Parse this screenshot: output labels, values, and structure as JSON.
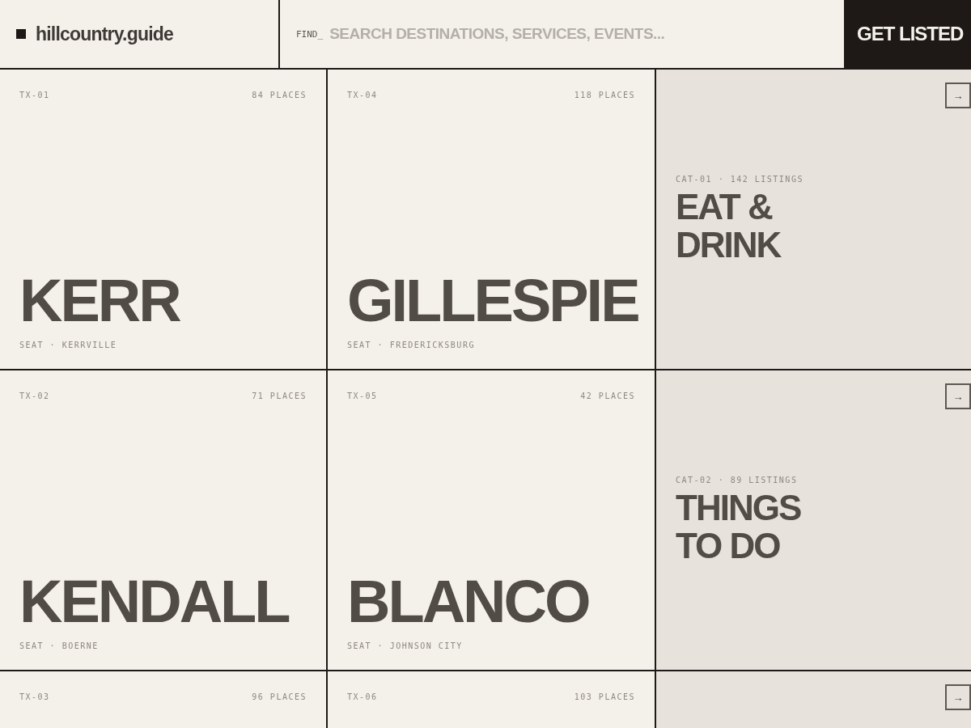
{
  "header": {
    "logo": "hillcountry.guide",
    "search": {
      "label": "FIND_",
      "placeholder": "SEARCH DESTINATIONS, SERVICES, EVENTS..."
    },
    "cta": "GET LISTED"
  },
  "rows": [
    {
      "counties": [
        {
          "code": "TX-01",
          "places": "84 PLACES",
          "name": "KERR",
          "seat": "SEAT · KERRVILLE"
        },
        {
          "code": "TX-04",
          "places": "118 PLACES",
          "name": "GILLESPIE",
          "seat": "SEAT · FREDERICKSBURG"
        }
      ],
      "category": {
        "label": "CAT-01 · 142 LISTINGS",
        "title": "EAT &\nDRINK",
        "arrow": "→"
      }
    },
    {
      "counties": [
        {
          "code": "TX-02",
          "places": "71 PLACES",
          "name": "KENDALL",
          "seat": "SEAT · BOERNE"
        },
        {
          "code": "TX-05",
          "places": "42 PLACES",
          "name": "BLANCO",
          "seat": "SEAT · JOHNSON CITY"
        }
      ],
      "category": {
        "label": "CAT-02 · 89 LISTINGS",
        "title": "THINGS\nTO DO",
        "arrow": "→"
      }
    },
    {
      "counties": [
        {
          "code": "TX-03",
          "places": "96 PLACES"
        },
        {
          "code": "TX-06",
          "places": "103 PLACES"
        }
      ],
      "category": {
        "arrow": "→"
      }
    }
  ]
}
